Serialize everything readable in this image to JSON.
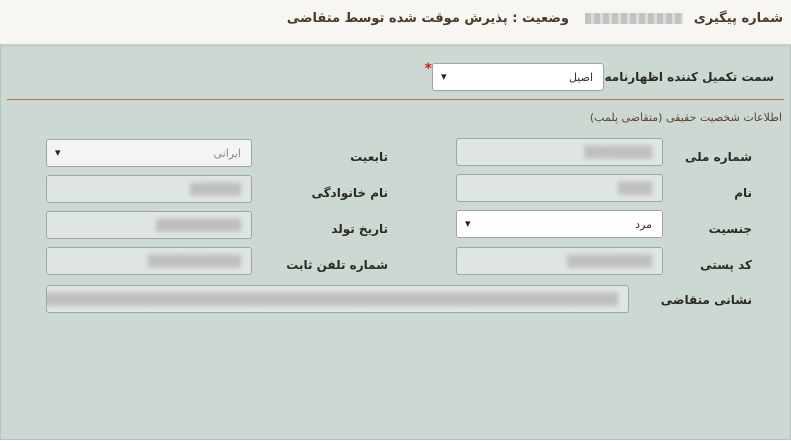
{
  "header": {
    "tracking_label": "شماره پیگیری",
    "tracking_value": "████████████",
    "status_text": "وضعیت : پذیرش موقت شده توسط متقاضی"
  },
  "applicant_role": {
    "label": "سمت تکمیل کننده اظهارنامه",
    "required_mark": "*",
    "selected": "اصیل"
  },
  "section": {
    "title": "اطلاعات شخصیت حقیقی (متقاضی پلمب)"
  },
  "form": {
    "national_id": {
      "label": "شماره ملی",
      "value": "████████"
    },
    "nationality": {
      "label": "تابعیت",
      "selected": "ایرانی"
    },
    "first_name": {
      "label": "نام",
      "value": "████"
    },
    "last_name": {
      "label": "نام خانوادگی",
      "value": "██████"
    },
    "gender": {
      "label": "جنسیت",
      "selected": "مرد"
    },
    "birth_date": {
      "label": "تاریخ تولد",
      "value": "██████████"
    },
    "postal_code": {
      "label": "کد پستی",
      "value": "██████████"
    },
    "phone": {
      "label": "شماره تلفن ثابت",
      "value": "███████████"
    },
    "address": {
      "label": "نشانی متقاضی",
      "value": "████████████████████████████████████████████████████████████████████████████████"
    }
  },
  "icons": {
    "dropdown": "chevron-down-icon"
  }
}
